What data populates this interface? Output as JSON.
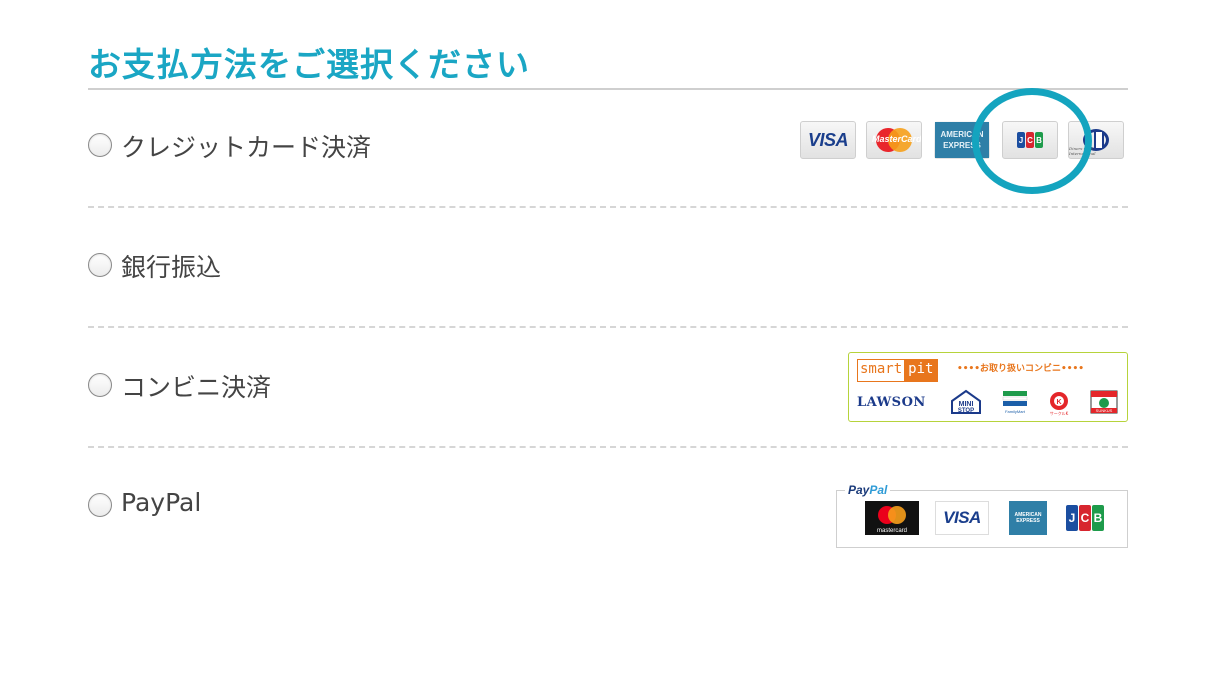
{
  "header": {
    "title": "お支払方法をご選択ください"
  },
  "payment_options": [
    {
      "label": "クレジットカード決済",
      "selected": false
    },
    {
      "label": "銀行振込",
      "selected": false
    },
    {
      "label": "コンビニ決済",
      "selected": false
    },
    {
      "label": "PayPal",
      "selected": false
    }
  ],
  "credit_cards": {
    "visa": "VISA",
    "mastercard": "MasterCard",
    "amex_line1": "AMERICAN",
    "amex_line2": "EXPRESS",
    "jcb": [
      "J",
      "C",
      "B"
    ],
    "diners": "Diners Club International"
  },
  "convenience": {
    "smartpit_a": "smart",
    "smartpit_b": "pit",
    "note": "••••お取り扱いコンビニ••••",
    "lawson": "LAWSON",
    "ministop": "MINI STOP",
    "familymart": "FamilyMart",
    "circlek": "サークルK",
    "sunkus": "SUNKUS"
  },
  "paypal": {
    "logo_a": "Pay",
    "logo_b": "Pal",
    "mastercard": "mastercard",
    "visa": "VISA",
    "amex": "AMERICAN EXPRESS",
    "jcb": [
      "J",
      "C",
      "B"
    ]
  },
  "colors": {
    "title": "#1aa6c4",
    "highlight_ring": "#14a4bf",
    "smartpit_orange": "#e8761d",
    "convenience_border": "#b6d33b",
    "jcb_blue": "#1b4ea0",
    "jcb_red": "#d7262f",
    "jcb_green": "#1e9b4b"
  },
  "annotations": {
    "highlight": "circle-around-jcb-logo"
  }
}
